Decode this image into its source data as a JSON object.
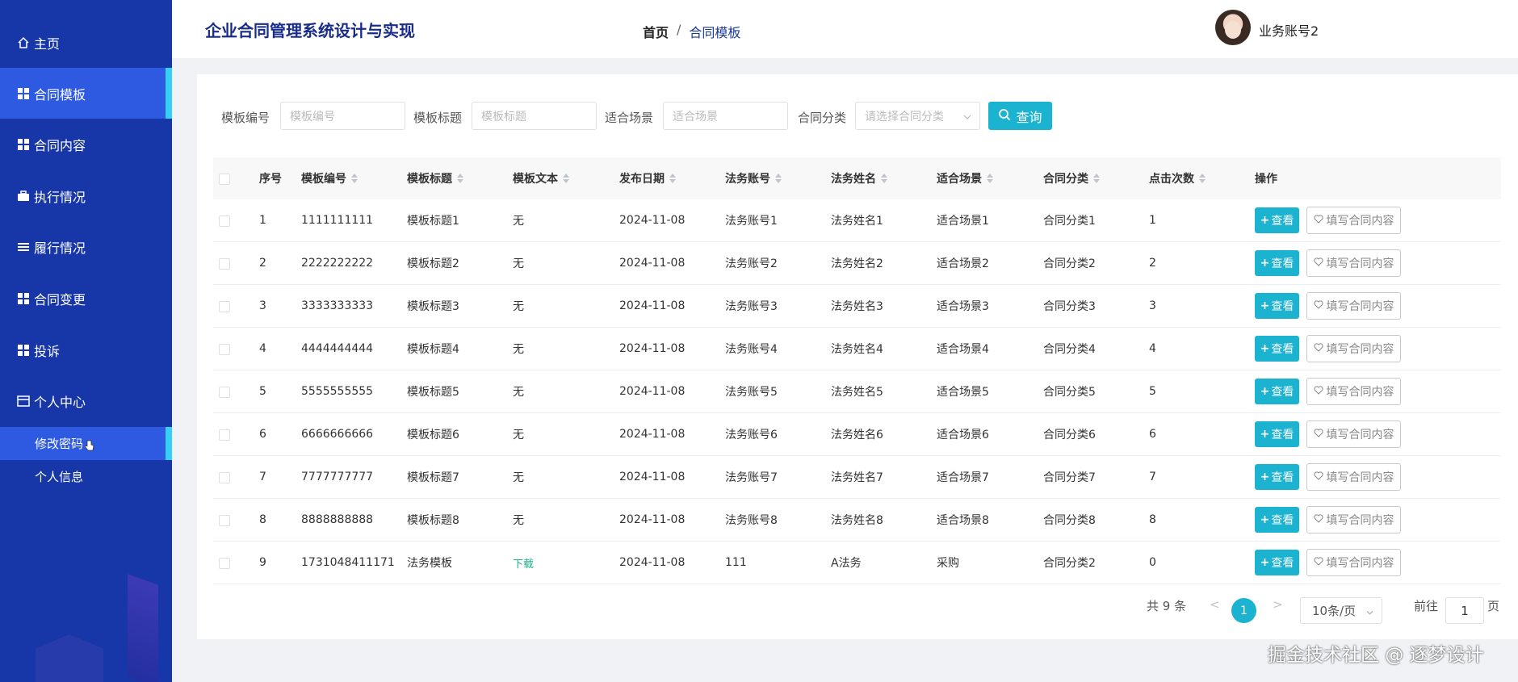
{
  "sidebar": {
    "items": [
      {
        "label": "主页",
        "icon": "home-icon"
      },
      {
        "label": "合同模板",
        "icon": "grid-icon",
        "active": true
      },
      {
        "label": "合同内容",
        "icon": "grid-icon"
      },
      {
        "label": "执行情况",
        "icon": "briefcase-icon"
      },
      {
        "label": "履行情况",
        "icon": "list-icon"
      },
      {
        "label": "合同变更",
        "icon": "grid-icon"
      },
      {
        "label": "投诉",
        "icon": "grid-icon"
      },
      {
        "label": "个人中心",
        "icon": "window-icon"
      }
    ],
    "subitems": [
      {
        "label": "修改密码",
        "active": true
      },
      {
        "label": "个人信息"
      }
    ]
  },
  "header": {
    "title": "企业合同管理系统设计与实现",
    "breadcrumb": {
      "home": "首页",
      "sep": "/",
      "current": "合同模板"
    },
    "user": "业务账号2"
  },
  "search": {
    "fields": [
      {
        "label": "模板编号",
        "placeholder": "模板编号"
      },
      {
        "label": "模板标题",
        "placeholder": "模板标题"
      },
      {
        "label": "适合场景",
        "placeholder": "适合场景"
      },
      {
        "label": "合同分类",
        "placeholder": "请选择合同分类"
      }
    ],
    "button": "查询"
  },
  "table": {
    "columns": [
      "序号",
      "模板编号",
      "模板标题",
      "模板文本",
      "发布日期",
      "法务账号",
      "法务姓名",
      "适合场景",
      "合同分类",
      "点击次数",
      "操作"
    ],
    "rows": [
      [
        "1",
        "1111111111",
        "模板标题1",
        "无",
        "2024-11-08",
        "法务账号1",
        "法务姓名1",
        "适合场景1",
        "合同分类1",
        "1"
      ],
      [
        "2",
        "2222222222",
        "模板标题2",
        "无",
        "2024-11-08",
        "法务账号2",
        "法务姓名2",
        "适合场景2",
        "合同分类2",
        "2"
      ],
      [
        "3",
        "3333333333",
        "模板标题3",
        "无",
        "2024-11-08",
        "法务账号3",
        "法务姓名3",
        "适合场景3",
        "合同分类3",
        "3"
      ],
      [
        "4",
        "4444444444",
        "模板标题4",
        "无",
        "2024-11-08",
        "法务账号4",
        "法务姓名4",
        "适合场景4",
        "合同分类4",
        "4"
      ],
      [
        "5",
        "5555555555",
        "模板标题5",
        "无",
        "2024-11-08",
        "法务账号5",
        "法务姓名5",
        "适合场景5",
        "合同分类5",
        "5"
      ],
      [
        "6",
        "6666666666",
        "模板标题6",
        "无",
        "2024-11-08",
        "法务账号6",
        "法务姓名6",
        "适合场景6",
        "合同分类6",
        "6"
      ],
      [
        "7",
        "7777777777",
        "模板标题7",
        "无",
        "2024-11-08",
        "法务账号7",
        "法务姓名7",
        "适合场景7",
        "合同分类7",
        "7"
      ],
      [
        "8",
        "8888888888",
        "模板标题8",
        "无",
        "2024-11-08",
        "法务账号8",
        "法务姓名8",
        "适合场景8",
        "合同分类8",
        "8"
      ],
      [
        "9",
        "1731048411171",
        "法务模板",
        "下载",
        "2024-11-08",
        "111",
        "A法务",
        "采购",
        "合同分类2",
        "0"
      ]
    ],
    "view_label": "查看",
    "fill_label": "填写合同内容"
  },
  "pagination": {
    "total": "共 9 条",
    "prev": "<",
    "current": "1",
    "next": ">",
    "page_size": "10条/页",
    "goto_prefix": "前往",
    "goto_value": "1",
    "goto_suffix": "页"
  },
  "watermark": "掘金技术社区 @ 逐梦设计",
  "colors": {
    "sidebar": "#1736a8",
    "active": "#2d5ae0",
    "accent": "#1bb3d0",
    "indicator": "#36d0f5"
  }
}
